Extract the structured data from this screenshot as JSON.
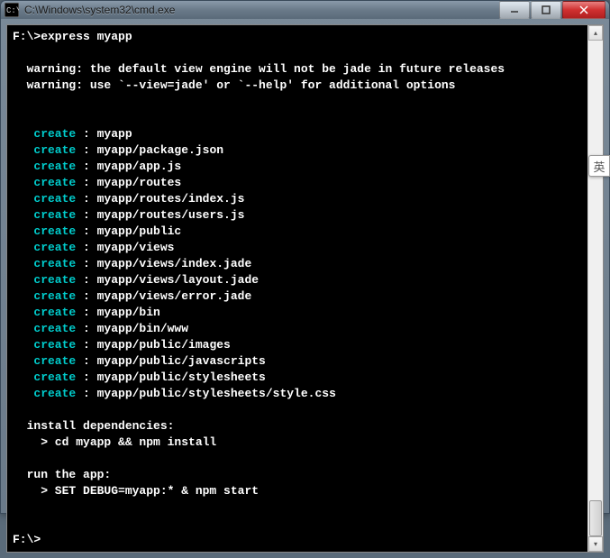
{
  "window": {
    "title": "C:\\Windows\\system32\\cmd.exe"
  },
  "terminal": {
    "prompt1_path": "F:\\>",
    "prompt1_cmd": "express myapp",
    "warning1": "  warning: the default view engine will not be jade in future releases",
    "warning2": "  warning: use `--view=jade' or `--help' for additional options",
    "create_label": "create",
    "creates": [
      "myapp",
      "myapp/package.json",
      "myapp/app.js",
      "myapp/routes",
      "myapp/routes/index.js",
      "myapp/routes/users.js",
      "myapp/public",
      "myapp/views",
      "myapp/views/index.jade",
      "myapp/views/layout.jade",
      "myapp/views/error.jade",
      "myapp/bin",
      "myapp/bin/www",
      "myapp/public/images",
      "myapp/public/javascripts",
      "myapp/public/stylesheets",
      "myapp/public/stylesheets/style.css"
    ],
    "install_header": "  install dependencies:",
    "install_cmd": "    > cd myapp && npm install",
    "run_header": "  run the app:",
    "run_cmd": "    > SET DEBUG=myapp:* & npm start",
    "prompt2_path": "F:\\>"
  },
  "ime": {
    "label": "英"
  }
}
